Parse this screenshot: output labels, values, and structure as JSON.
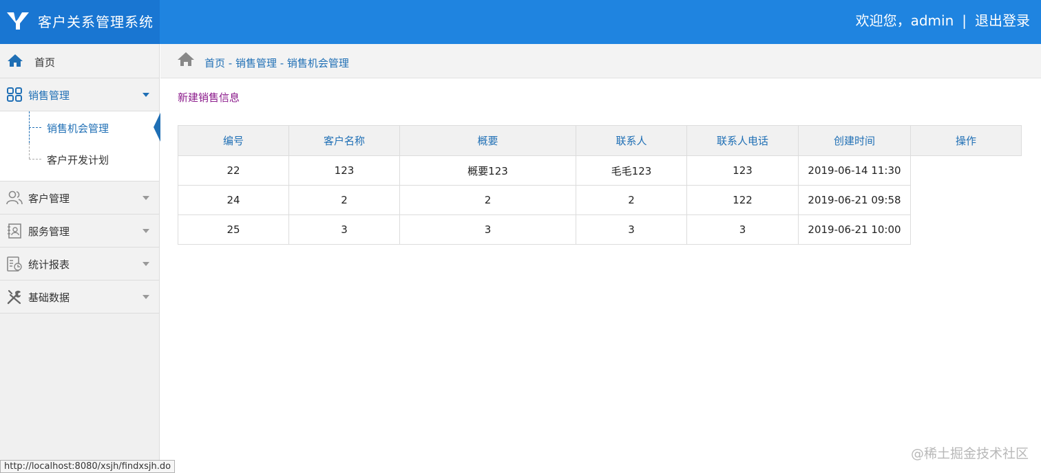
{
  "header": {
    "app_title": "客户关系管理系统",
    "welcome": "欢迎您，admin",
    "separator": "|",
    "logout": "退出登录",
    "bg_color": "#1f84e0"
  },
  "sidebar": {
    "home": "首页",
    "sales": {
      "label": "销售管理",
      "children": [
        "销售机会管理",
        "客户开发计划"
      ]
    },
    "customer": "客户管理",
    "service": "服务管理",
    "stats": "统计报表",
    "basic": "基础数据"
  },
  "breadcrumb": "首页 - 销售管理 - 销售机会管理",
  "main": {
    "new_link": "新建销售信息",
    "table": {
      "headers": [
        "编号",
        "客户名称",
        "概要",
        "联系人",
        "联系人电话",
        "创建时间",
        "操作"
      ],
      "rows": [
        [
          "22",
          "123",
          "概要123",
          "毛毛123",
          "123",
          "2019-06-14 11:30"
        ],
        [
          "24",
          "2",
          "2",
          "2",
          "122",
          "2019-06-21 09:58"
        ],
        [
          "25",
          "3",
          "3",
          "3",
          "3",
          "2019-06-21 10:00"
        ]
      ]
    }
  },
  "status_url": "http://localhost:8080/xsjh/findxsjh.do",
  "watermark": "@稀土掘金技术社区",
  "colors": {
    "accent": "#1f6fb5",
    "link_purple": "#8b1a8b"
  }
}
